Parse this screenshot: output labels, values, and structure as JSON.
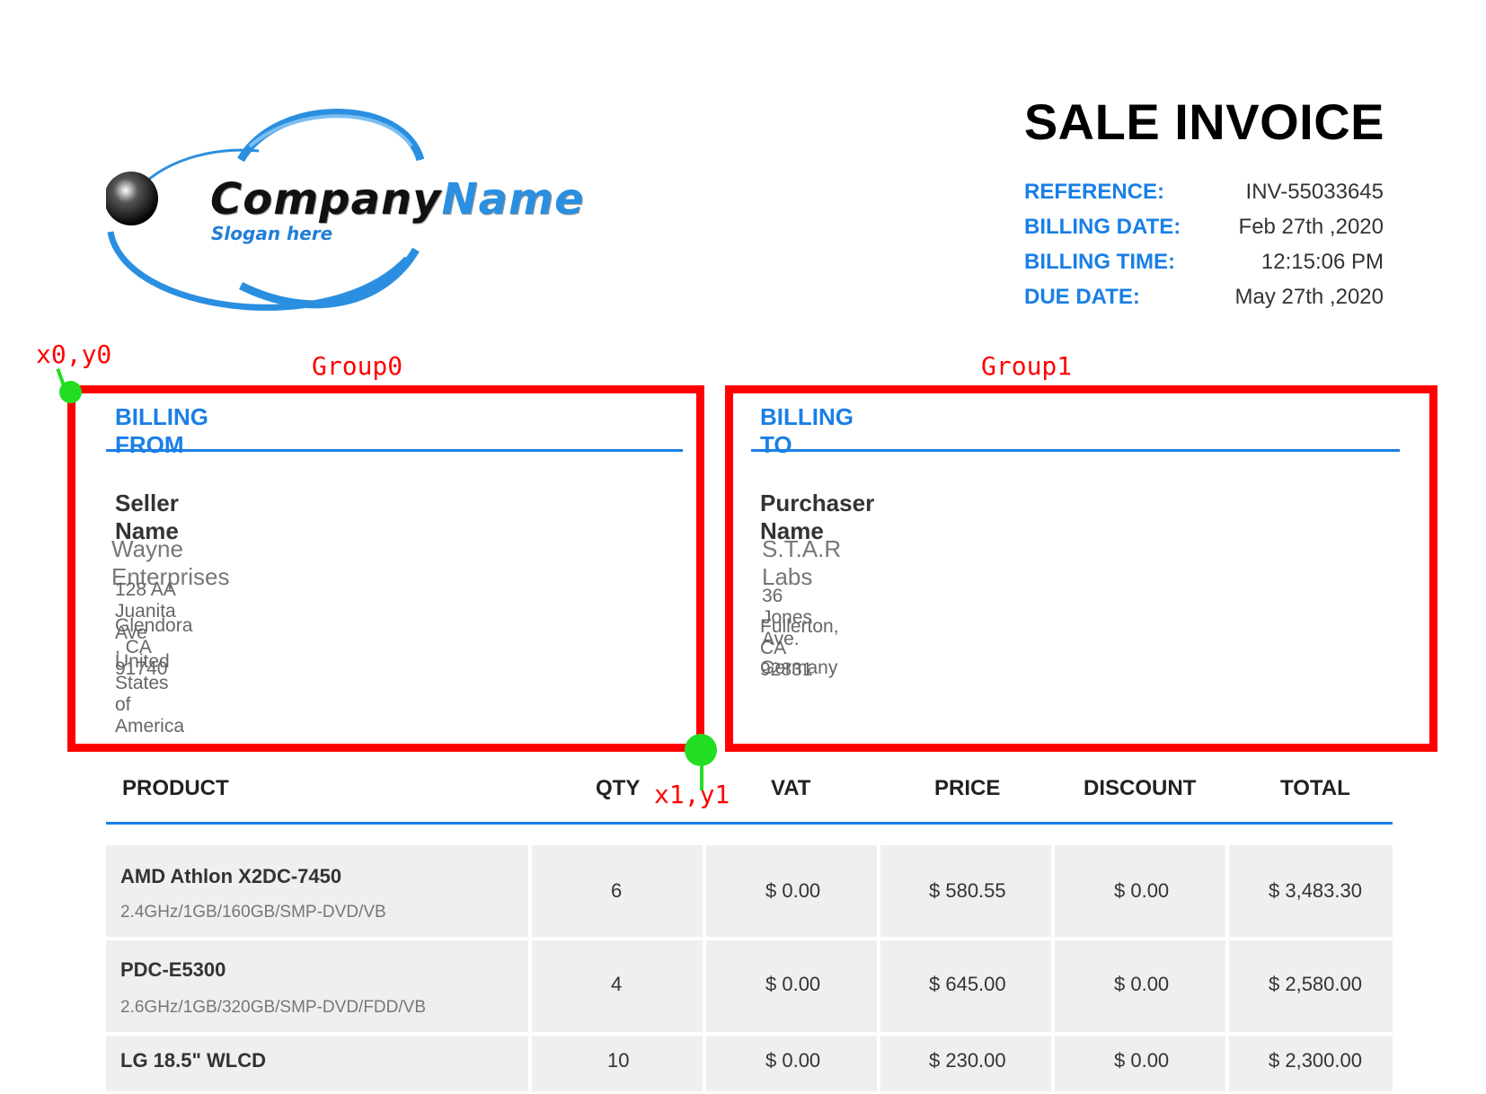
{
  "logo": {
    "name_main": "Company",
    "name_accent": "Name",
    "slogan": "Slogan here"
  },
  "title": "SALE INVOICE",
  "meta": [
    {
      "label": "REFERENCE:",
      "value": "INV-55033645"
    },
    {
      "label": "BILLING DATE:",
      "value": "Feb 27th ,2020"
    },
    {
      "label": "BILLING TIME:",
      "value": "12:15:06 PM"
    },
    {
      "label": "DUE DATE:",
      "value": "May 27th ,2020"
    }
  ],
  "annotations": {
    "group0": "Group0",
    "group1": "Group1",
    "corner_start": "x0,y0",
    "corner_end": "x1,y1"
  },
  "billing_from": {
    "heading": "BILLING FROM",
    "name_label": "Seller Name",
    "company": "Wayne Enterprises",
    "lines": [
      "128 AA Juanita Ave",
      "Glendora , CA 91740",
      "United States of America"
    ]
  },
  "billing_to": {
    "heading": "BILLING TO",
    "name_label": "Purchaser Name",
    "company": "S.T.A.R Labs",
    "lines": [
      "36 Jones Ave.",
      "Fullerton, CA 92831",
      "Germany"
    ]
  },
  "table": {
    "headers": [
      "PRODUCT",
      "QTY",
      "VAT",
      "PRICE",
      "DISCOUNT",
      "TOTAL"
    ],
    "rows": [
      {
        "product": "AMD Athlon X2DC-7450",
        "spec": "2.4GHz/1GB/160GB/SMP-DVD/VB",
        "qty": "6",
        "vat": "$ 0.00",
        "price": "$ 580.55",
        "discount": "$ 0.00",
        "total": "$ 3,483.30"
      },
      {
        "product": "PDC-E5300",
        "spec": "2.6GHz/1GB/320GB/SMP-DVD/FDD/VB",
        "qty": "4",
        "vat": "$ 0.00",
        "price": "$ 645.00",
        "discount": "$ 0.00",
        "total": "$ 2,580.00"
      },
      {
        "product": "LG 18.5\" WLCD",
        "spec": "",
        "qty": "10",
        "vat": "$ 0.00",
        "price": "$ 230.00",
        "discount": "$ 0.00",
        "total": "$ 2,300.00"
      }
    ]
  },
  "colors": {
    "accent": "#1a7fe6",
    "annotation": "#ff0000",
    "marker": "#22dd22",
    "row_bg": "#efefef"
  }
}
